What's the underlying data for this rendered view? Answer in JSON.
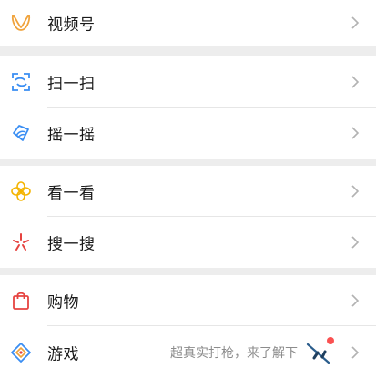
{
  "menu": {
    "items": [
      {
        "label": "视频号",
        "icon": "channels-icon",
        "color": "#f0a33c"
      },
      {
        "label": "扫一扫",
        "icon": "scan-icon",
        "color": "#3a8ef3"
      },
      {
        "label": "摇一摇",
        "icon": "shake-icon",
        "color": "#3a8ef3"
      },
      {
        "label": "看一看",
        "icon": "top-stories-icon",
        "color": "#f4b400"
      },
      {
        "label": "搜一搜",
        "icon": "search-icon",
        "color": "#e64340"
      },
      {
        "label": "购物",
        "icon": "shopping-bag-icon",
        "color": "#e64340"
      },
      {
        "label": "游戏",
        "icon": "games-icon",
        "color": "#3a8ef3"
      }
    ],
    "games_promo": "超真实打枪，来了解下"
  },
  "colors": {
    "background": "#ededed",
    "card": "#ffffff",
    "text": "#1a1a1a",
    "secondary_text": "#8c8c8c",
    "chevron": "#b2b2b2",
    "badge": "#fa5151"
  }
}
